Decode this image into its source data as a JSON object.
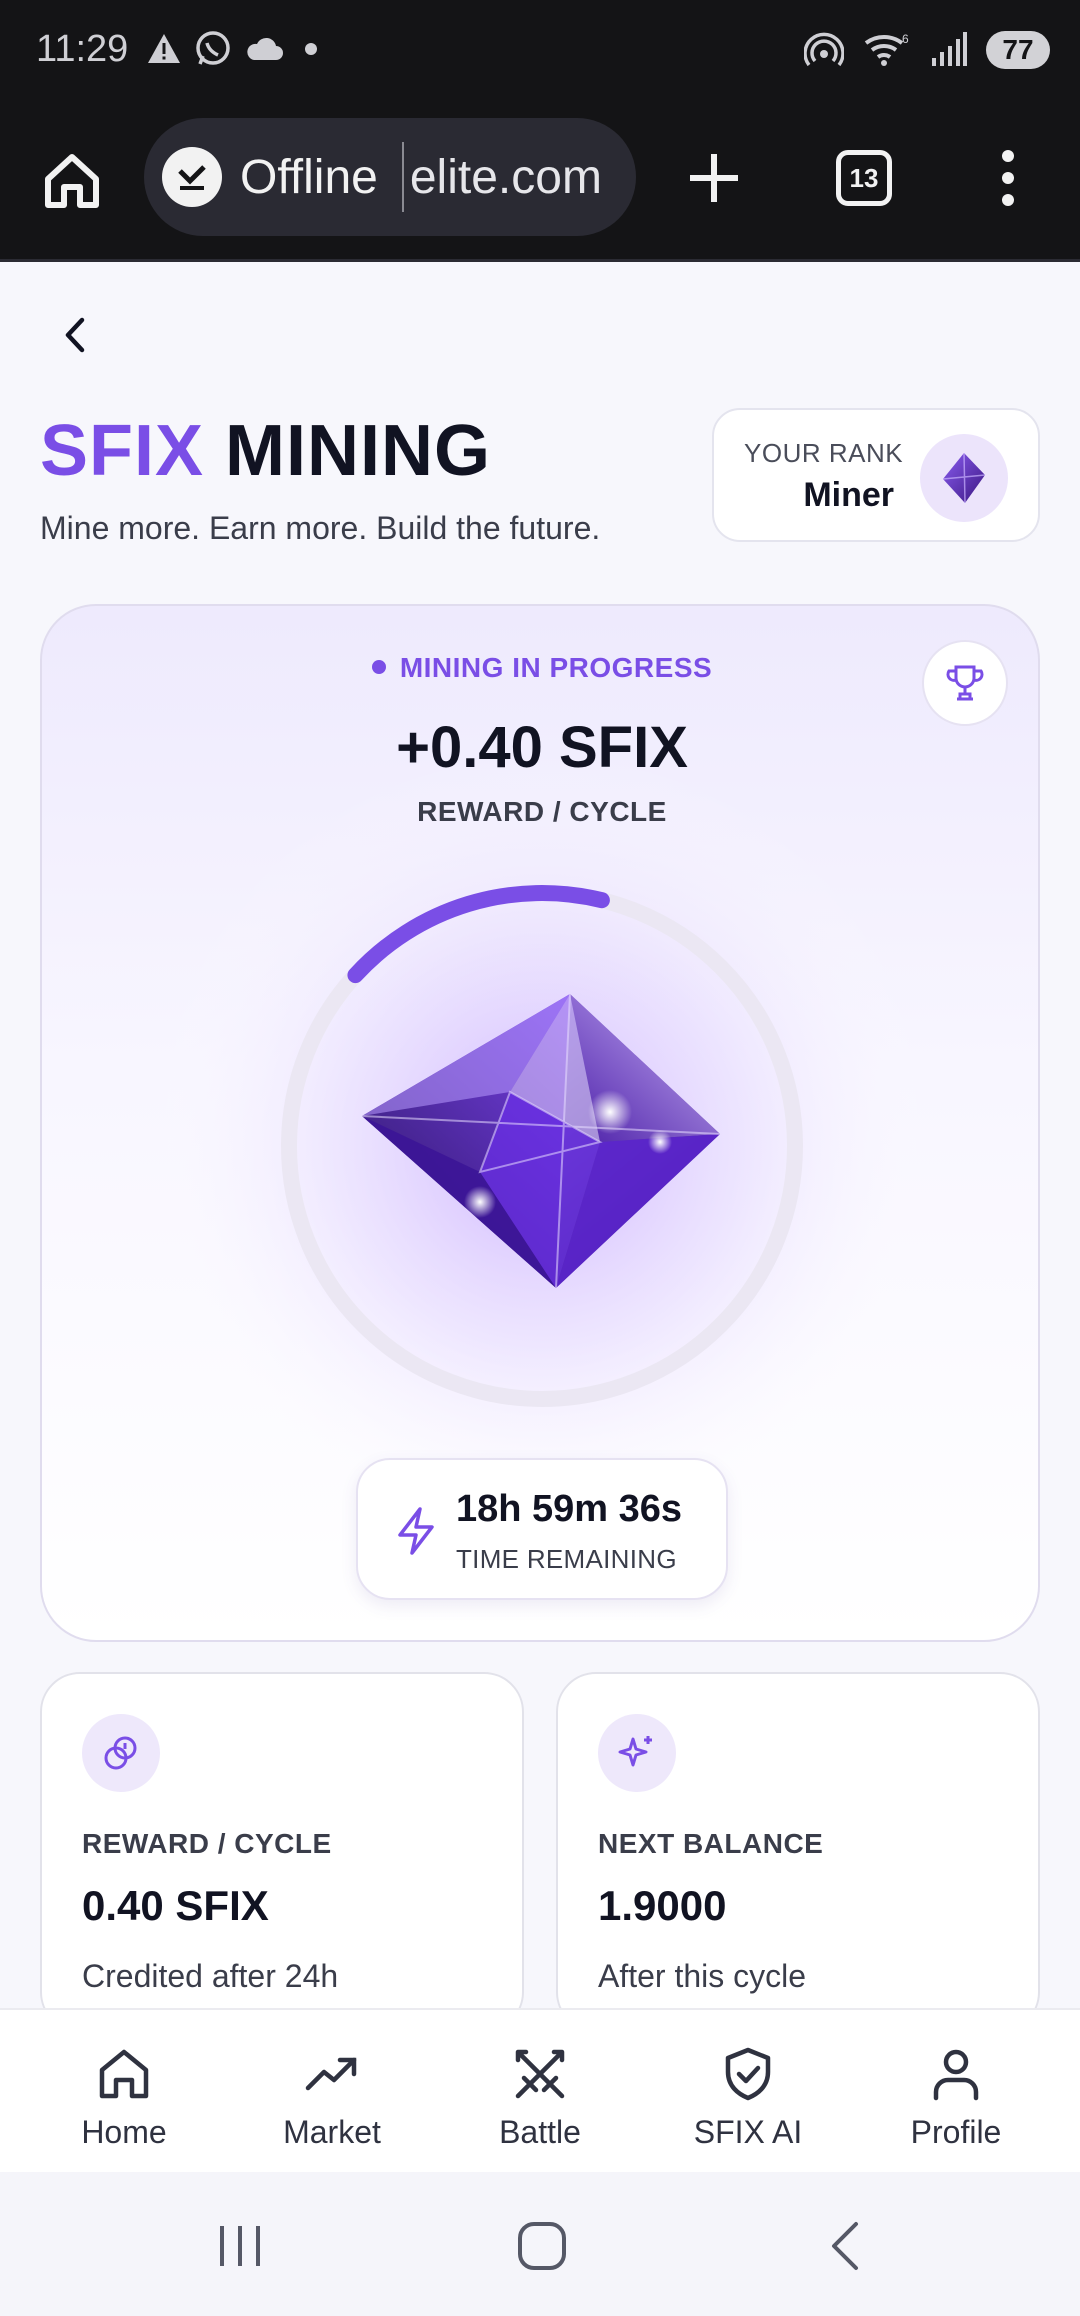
{
  "status_bar": {
    "time": "11:29",
    "battery": "77"
  },
  "browser": {
    "offline_label": "Offline",
    "url": "elite.com",
    "tab_count": "13"
  },
  "header": {
    "title_accent": "SFIX",
    "title_main": "MINING",
    "subtitle": "Mine more. Earn more. Build the future."
  },
  "rank": {
    "label": "YOUR RANK",
    "value": "Miner"
  },
  "mining": {
    "status": "MINING IN PROGRESS",
    "reward": "+0.40 SFIX",
    "reward_caption": "REWARD / CYCLE",
    "progress_fraction": 0.17,
    "timer_value": "18h 59m 36s",
    "timer_label": "TIME REMAINING"
  },
  "stats": [
    {
      "label": "REWARD / CYCLE",
      "value": "0.40 SFIX",
      "note": "Credited after 24h",
      "icon": "coins-icon"
    },
    {
      "label": "NEXT BALANCE",
      "value": "1.9000",
      "note": "After this cycle",
      "icon": "sparkles-icon"
    }
  ],
  "nav": [
    {
      "label": "Home",
      "icon": "home-icon"
    },
    {
      "label": "Market",
      "icon": "trend-up-icon"
    },
    {
      "label": "Battle",
      "icon": "swords-icon"
    },
    {
      "label": "SFIX AI",
      "icon": "shield-check-icon"
    },
    {
      "label": "Profile",
      "icon": "user-icon"
    }
  ],
  "colors": {
    "accent": "#7a4ee6",
    "text": "#111322",
    "status_bar_bg": "#141416"
  }
}
